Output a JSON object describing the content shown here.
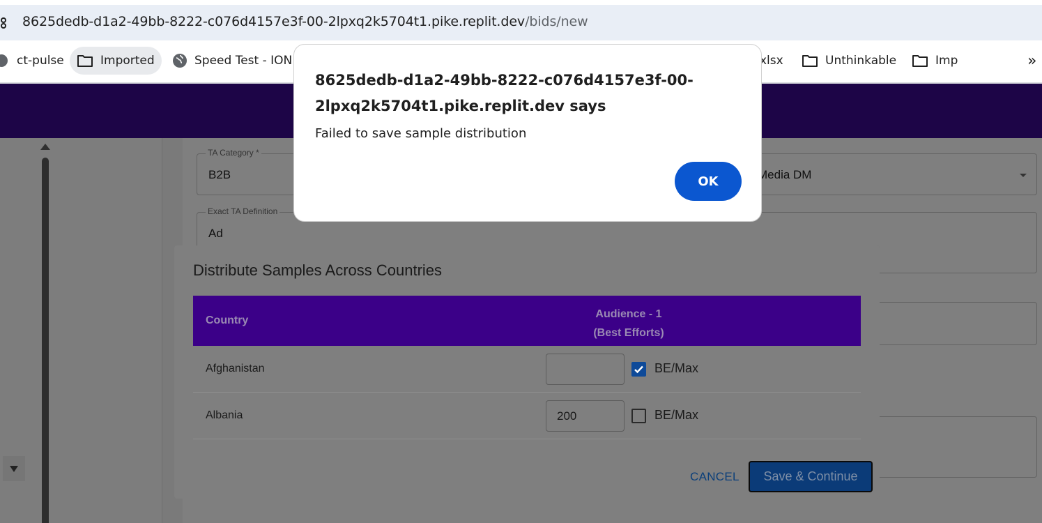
{
  "browser": {
    "url_host": "8625dedb-d1a2-49bb-8222-c076d4157e3f-00-2lpxq2k5704t1.pike.replit.dev",
    "url_path": "/bids/new",
    "bookmarks": [
      {
        "label": "ct-pulse",
        "icon": "globe-icon"
      },
      {
        "label": "Imported",
        "icon": "folder-icon"
      },
      {
        "label": "Speed Test - ION",
        "icon": "globe-icon"
      },
      {
        "label": "xlsx",
        "icon": "none"
      },
      {
        "label": "Unthinkable",
        "icon": "folder-icon"
      },
      {
        "label": "Imp",
        "icon": "folder-icon"
      }
    ],
    "overflow_label": "»"
  },
  "form": {
    "ta_category": {
      "label": "TA Category *",
      "value": "B2B"
    },
    "second_select": {
      "value": "Media DM"
    },
    "exact_ta_definition": {
      "label": "Exact TA Definition",
      "value": "Ad"
    }
  },
  "distribution_modal": {
    "title": "Distribute Samples Across Countries",
    "columns": {
      "country": "Country",
      "audience": "Audience - 1",
      "audience_note": "(Best Efforts)"
    },
    "rows": [
      {
        "country": "Afghanistan",
        "value": "",
        "be_max_label": "BE/Max",
        "be_max_checked": true
      },
      {
        "country": "Albania",
        "value": "200",
        "be_max_label": "BE/Max",
        "be_max_checked": false
      }
    ],
    "cancel_label": "CANCEL",
    "save_label": "Save & Continue"
  },
  "alert": {
    "title": "8625dedb-d1a2-49bb-8222-c076d4157e3f-00-2lpxq2k5704t1.pike.replit.dev says",
    "message": "Failed to save sample distribution",
    "ok_label": "OK"
  },
  "colors": {
    "header_purple": "#3b0a8f",
    "table_header": "#3b0088",
    "ok_button": "#0b57d0",
    "save_button": "#0b3b78"
  }
}
